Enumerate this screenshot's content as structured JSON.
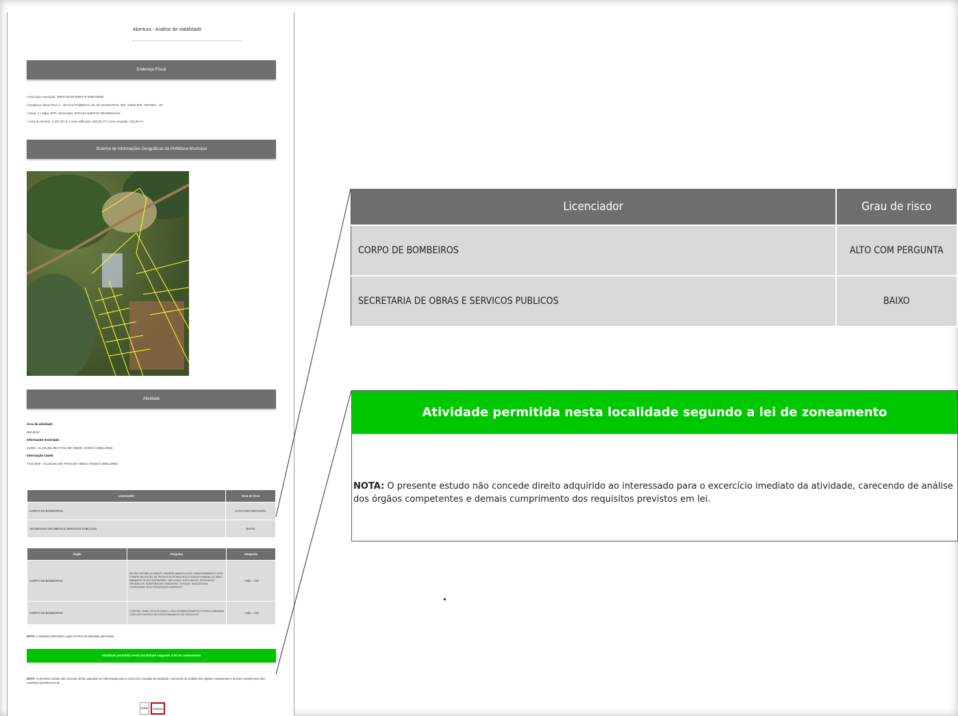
{
  "mini_page": {
    "title": "Abertura - Análise de viabilidade",
    "section_fiscal": "Endereço Fiscal",
    "fiscal_lines": [
      "• Inscrição municipal: 20001-03-58-00007-0-0288-00000",
      "• Endereço fiscal: RUA 1 - 00 GAS PAMERAS, 00, 00, MANDAPAS, 000, 13530-000, TIETEBA - SP",
      "• Zona: 1 | Sigla: ZPR | Descrição: PARCELAMENTO RESIDENCIAL",
      "• Área do terreno: 1.237,00 m² | Área edificada: 180,00 m² | Área ocupada: 150,00 m²"
    ],
    "section_sig": "Sistema de Informações Geográficas da Prefeitura Municipal",
    "section_activity": "Atividade",
    "activity": {
      "area_label": "Área da atividade:",
      "area_value": "000,00m²",
      "municipal_label": "Informação municipal:",
      "municipal_value": "21000 - ALUGUEL DE FITAS DE VÍDEO, DVDS E SIMILARES",
      "cnae_label": "Informação CNAE:",
      "cnae_value": "7722-5/00 - ALUGUEL DE FITAS DE VÍDEO, DVDS E SIMILARES"
    },
    "lic_headers": [
      "Licenciador",
      "Grau de risco"
    ],
    "lic_rows": [
      [
        "CORPO DE BOMBEIROS",
        "ALTO COM PERGUNTA"
      ],
      [
        "SECRETARIA DE OBRAS E SERVICOS PUBLICOS",
        "BAIXO"
      ]
    ],
    "q_headers": [
      "Órgão",
      "Pergunta",
      "Resposta"
    ],
    "q_rows": [
      [
        "CORPO DE BOMBEIROS",
        "EM SEU ESTABELECIMENTO HAVERÁ MANIPULAÇÃO, ARMAZENAMENTO E/OU COMERCIALIZAÇÃO DE PRODUTOS PERIGOSOS À SAÚDE HUMANA, AO MEIO AMBIENTE OU AO PATRIMÔNIO, TAIS COMO: EXPLOSIVOS, PERÓXIDOS ORGÂNICOS, SUBSTÂNCIAS OXIDANTES, TÓXICAS, RADIOATIVAS, CORROSIVAS E/OU PERIGOSOS DIVERSOS?",
        "○ Não ○ Sim"
      ],
      [
        "CORPO DE BOMBEIROS",
        "O IMÓVEL ONDE ESTÁ SITUADO O SEU ESTABELECIMENTO POSSUI GARAGEM COM USO DIVERSO DE ESTACIONAMENTO DE VEÍCULOS?",
        "○ Não ○ Sim"
      ]
    ],
    "q_note_label": "NOTA:",
    "q_note": "A resposta SIM reduz o grau de risco da atividade para baixo.",
    "green_text": "Atividade permitida nesta localidade segundo a lei de zoneamento",
    "bottom_note_label": "NOTA:",
    "bottom_note": "O presente estudo não concede direito adquirido ao interessado para o excercício imediato da atividade, carecendo de análise dos órgãos competentes e demais cumprimento dos requisitos previstos em lei.",
    "btn_back": "Voltar",
    "btn_next": "Avançar"
  },
  "zoom_table": {
    "headers": [
      "Licenciador",
      "Grau de risco"
    ],
    "rows": [
      {
        "licenciador": "CORPO DE BOMBEIROS",
        "risco": "ALTO COM PERGUNTA"
      },
      {
        "licenciador": "SECRETARIA DE OBRAS E SERVICOS PUBLICOS",
        "risco": "BAIXO"
      }
    ]
  },
  "zoom_panel": {
    "green_text": "Atividade permitida nesta localidade segundo a lei de zoneamento",
    "note_label": "NOTA:",
    "note_text": " O presente estudo não concede direito adquirido ao interessado para o excercício imediato da atividade, carecendo de análise dos órgãos competentes e demais cumprimento dos requisitos previstos em lei."
  },
  "colors": {
    "header_gray": "#6e6e6e",
    "cell_gray": "#d9d9d9",
    "green": "#00c800",
    "highlight_red": "#cc0000"
  }
}
